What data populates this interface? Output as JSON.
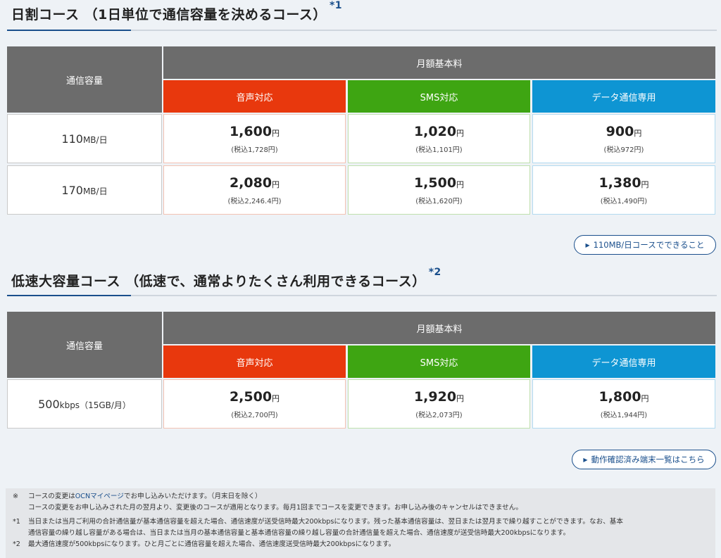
{
  "section1": {
    "title": "日割コース （1日単位で通信容量を決めるコース）",
    "note": "*1",
    "table": {
      "capacity_header": "通信容量",
      "monthly_header": "月額基本料",
      "plans": [
        "音声対応",
        "SMS対応",
        "データ通信専用"
      ],
      "rows": [
        {
          "capacity": "110",
          "unit": "MB/日",
          "prices": [
            {
              "price": "1,600",
              "yen": "円",
              "tax": "(税込1,728円)"
            },
            {
              "price": "1,020",
              "yen": "円",
              "tax": "(税込1,101円)"
            },
            {
              "price": "900",
              "yen": "円",
              "tax": "(税込972円)"
            }
          ]
        },
        {
          "capacity": "170",
          "unit": "MB/日",
          "prices": [
            {
              "price": "2,080",
              "yen": "円",
              "tax": "(税込2,246.4円)"
            },
            {
              "price": "1,500",
              "yen": "円",
              "tax": "(税込1,620円)"
            },
            {
              "price": "1,380",
              "yen": "円",
              "tax": "(税込1,490円)"
            }
          ]
        }
      ]
    },
    "link": "110MB/日コースでできること"
  },
  "section2": {
    "title": "低速大容量コース （低速で、通常よりたくさん利用できるコース）",
    "note": "*2",
    "table": {
      "capacity_header": "通信容量",
      "monthly_header": "月額基本料",
      "plans": [
        "音声対応",
        "SMS対応",
        "データ通信専用"
      ],
      "rows": [
        {
          "capacity": "500",
          "unit": "kbps",
          "extra": "（15GB/月）",
          "prices": [
            {
              "price": "2,500",
              "yen": "円",
              "tax": "(税込2,700円)"
            },
            {
              "price": "1,920",
              "yen": "円",
              "tax": "(税込2,073円)"
            },
            {
              "price": "1,800",
              "yen": "円",
              "tax": "(税込1,944円)"
            }
          ]
        }
      ]
    },
    "link": "動作確認済み端末一覧はこちら"
  },
  "notes": {
    "n0_mark": "※",
    "n0_pre": "コースの変更は",
    "n0_link": "OCNマイページ",
    "n0_post": "でお申し込みいただけます。（月末日を除く）",
    "n0_line2": "コースの変更をお申し込みされた月の翌月より、変更後のコースが適用となります。毎月1回までコースを変更できます。お申し込み後のキャンセルはできません。",
    "n1_mark": "*1",
    "n1_line1": "当日または当月ご利用の合計通信量が基本通信容量を超えた場合、通信速度が送受信時最大200kbpsになります。残った基本通信容量は、翌日または翌月まで繰り越すことができます。なお、基本",
    "n1_line2": "通信容量の繰り越し容量がある場合は、当日または当月の基本通信容量と基本通信容量の繰り越し容量の合計通信量を超えた場合、通信速度が送受信時最大200kbpsになります。",
    "n2_mark": "*2",
    "n2_line1": "最大通信速度が500kbpsになります。ひと月ごとに通信容量を超えた場合、通信速度送受信時最大200kbpsになります。"
  },
  "colors": {
    "voice": "#e8380d",
    "sms": "#3ea512",
    "data": "#0e95d3",
    "header": "#6c6c6c",
    "accent": "#1a4f8c"
  }
}
